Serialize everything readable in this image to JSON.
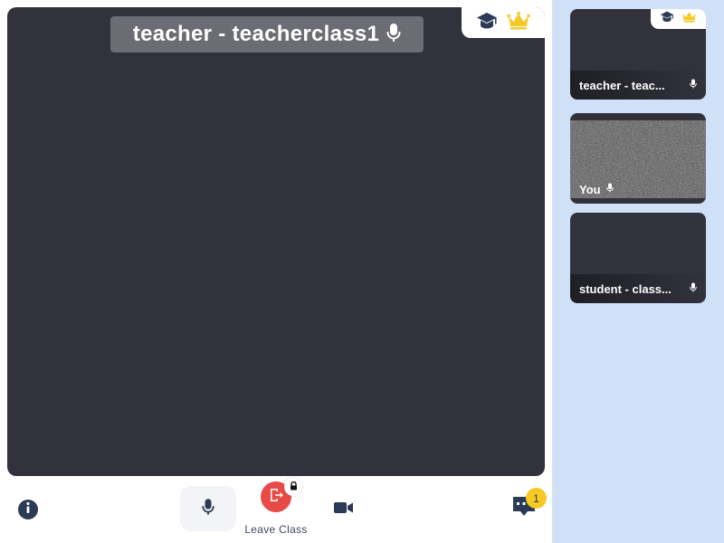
{
  "main": {
    "participant_name": "teacher - teacherclass1",
    "badge_icons": [
      "graduation-cap-icon",
      "crown-icon"
    ]
  },
  "sidebar": {
    "tiles": [
      {
        "label": "teacher - teac...",
        "badge_icons": [
          "graduation-cap-icon",
          "crown-icon"
        ],
        "video": "off"
      },
      {
        "label": "You",
        "video": "static-noise"
      },
      {
        "label": "student - class...",
        "video": "off"
      }
    ]
  },
  "toolbar": {
    "leave_label": "Leave Class",
    "chat_unread": "1"
  },
  "colors": {
    "stage": "#32323d",
    "sidebar": "#cfe0f7",
    "leave": "#e84a47",
    "crown": "#f6c924",
    "badge": "#f6c924",
    "icon": "#2b3a55"
  }
}
